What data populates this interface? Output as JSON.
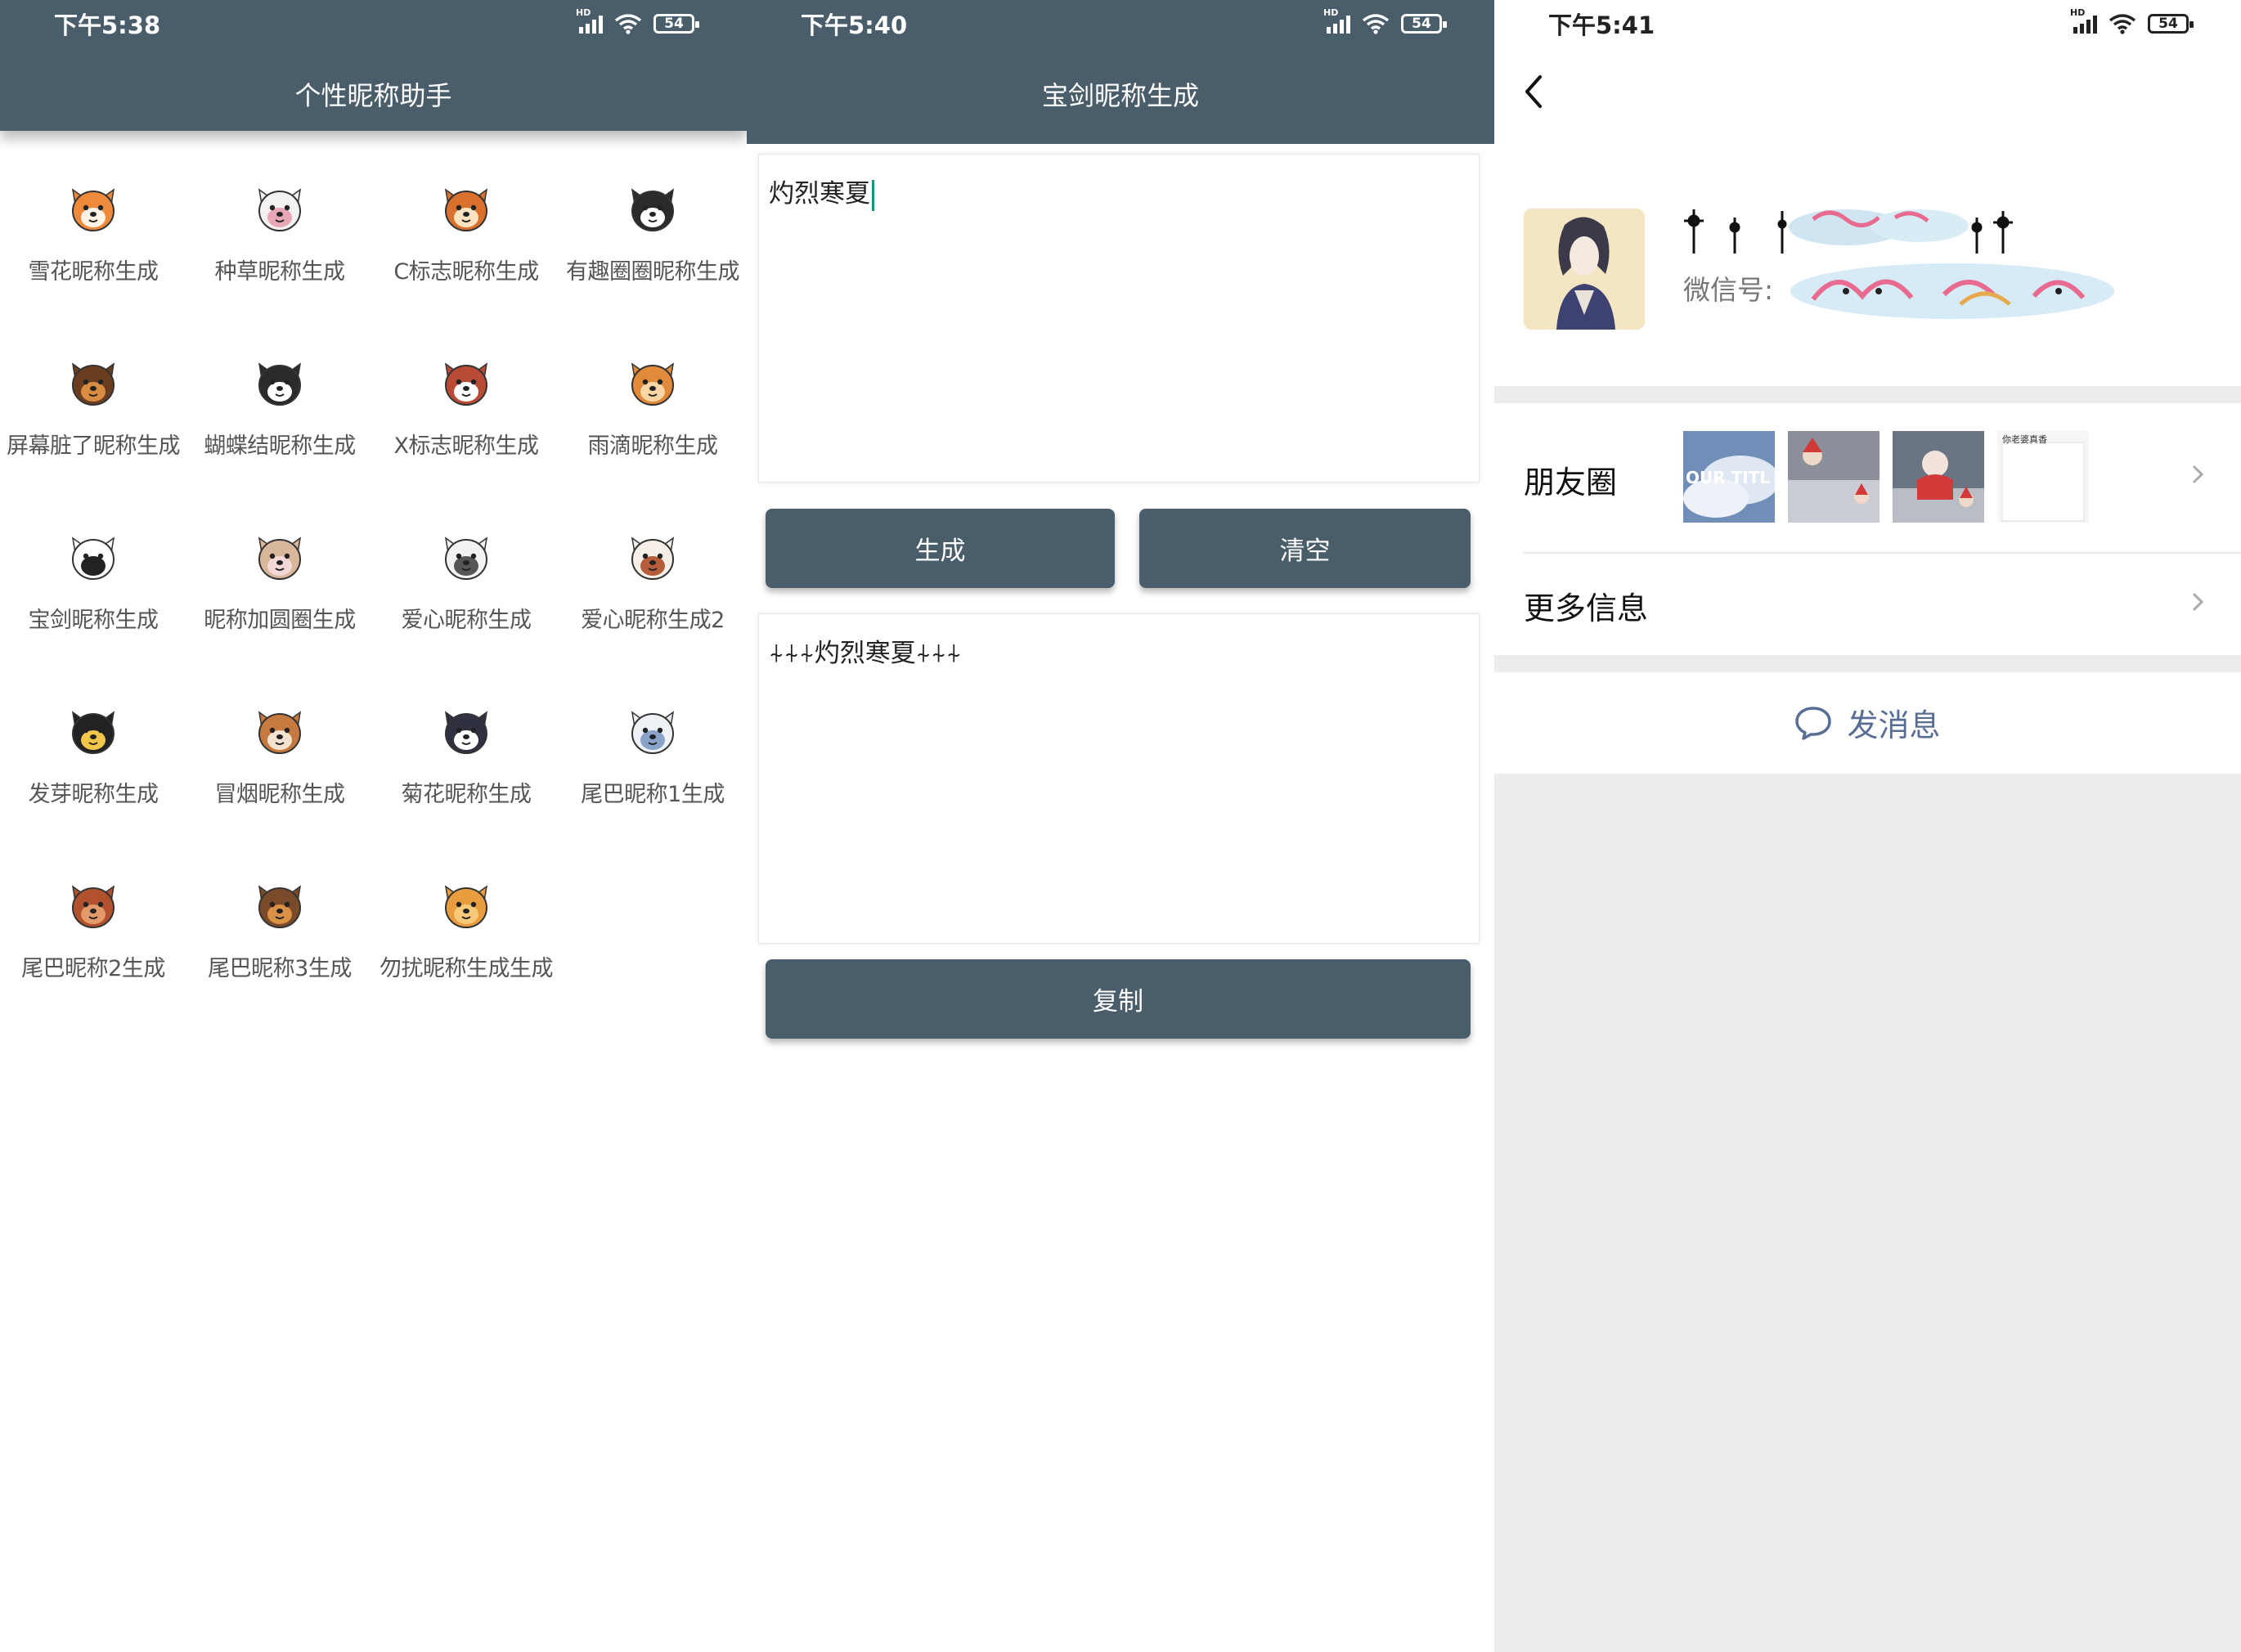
{
  "screen1": {
    "status_time": "下午5:38",
    "battery": "54",
    "signal_tag": "HD",
    "title": "个性昵称助手",
    "items": [
      {
        "label": "雪花昵称生成",
        "icon": "shiba-icon"
      },
      {
        "label": "种草昵称生成",
        "icon": "samoyed-icon"
      },
      {
        "label": "C标志昵称生成",
        "icon": "chipmunk-icon"
      },
      {
        "label": "有趣圈圈昵称生成",
        "icon": "tuxedo-cat-icon"
      },
      {
        "label": "屏幕脏了昵称生成",
        "icon": "german-shepherd-icon"
      },
      {
        "label": "蝴蝶结昵称生成",
        "icon": "husky-icon"
      },
      {
        "label": "X标志昵称生成",
        "icon": "spaniel-icon"
      },
      {
        "label": "雨滴昵称生成",
        "icon": "bear-icon"
      },
      {
        "label": "宝剑昵称生成",
        "icon": "panda-icon"
      },
      {
        "label": "昵称加圆圈生成",
        "icon": "rabbit-icon"
      },
      {
        "label": "爱心昵称生成",
        "icon": "white-dog-icon"
      },
      {
        "label": "爱心昵称生成2",
        "icon": "calico-cat-icon"
      },
      {
        "label": "发芽昵称生成",
        "icon": "black-cat-icon"
      },
      {
        "label": "冒烟昵称生成",
        "icon": "basset-hound-icon"
      },
      {
        "label": "菊花昵称生成",
        "icon": "shih-tzu-icon"
      },
      {
        "label": "尾巴昵称1生成",
        "icon": "poodle-icon"
      },
      {
        "label": "尾巴昵称2生成",
        "icon": "mastiff-icon"
      },
      {
        "label": "尾巴昵称3生成",
        "icon": "yorkie-icon"
      },
      {
        "label": "勿扰昵称生成生成",
        "icon": "golden-retriever-icon"
      }
    ]
  },
  "screen2": {
    "status_time": "下午5:40",
    "battery": "54",
    "signal_tag": "HD",
    "title": "宝剑昵称生成",
    "input_value": "灼烈寒夏",
    "generate_label": "生成",
    "clear_label": "清空",
    "output_value": "⍭⍭⍭灼烈寒夏⍭⍭⍭",
    "copy_label": "复制"
  },
  "screen3": {
    "status_time": "下午5:41",
    "battery": "54",
    "signal_tag": "HD",
    "wechat_id_label": "微信号:",
    "moments_label": "朋友圈",
    "thumb1_text": "OUR TITL",
    "thumb4_text": "你老婆真香",
    "more_info_label": "更多信息",
    "send_message_label": "发消息"
  },
  "colors": {
    "appbar": "#4a5d6a",
    "caret": "#19937b",
    "wechat_link": "#586c94",
    "panel3_bg": "#ededed"
  }
}
